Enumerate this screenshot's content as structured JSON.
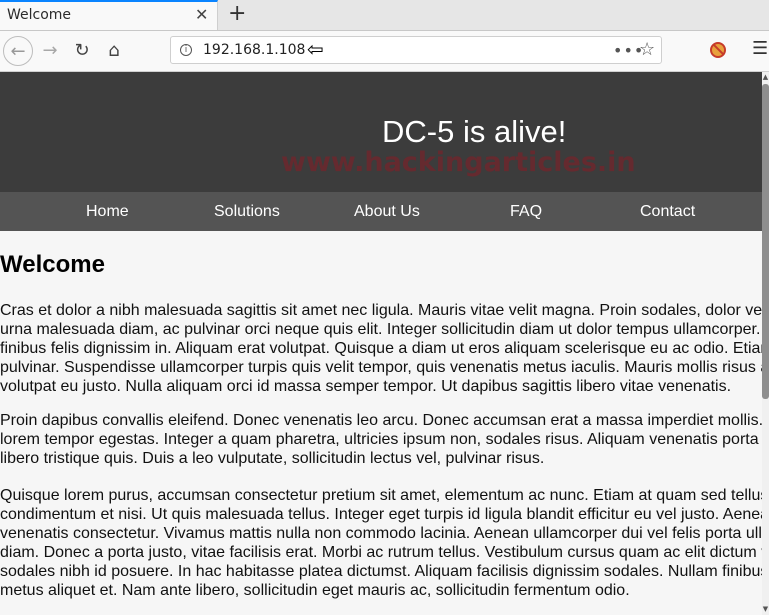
{
  "browser": {
    "tab_title": "Welcome",
    "tab_close": "✕",
    "new_tab": "+",
    "back": "←",
    "forward": "→",
    "reload": "↻",
    "home": "⌂",
    "url": "192.168.1.108",
    "info": "i",
    "cursor": "⇦",
    "page_actions": "•••",
    "bookmark": "☆",
    "menu": "☰"
  },
  "site": {
    "title": "DC-5 is alive!",
    "watermark": "www.hackingarticles.in",
    "nav": [
      "Home",
      "Solutions",
      "About Us",
      "FAQ",
      "Contact"
    ]
  },
  "content": {
    "heading": "Welcome",
    "paragraphs": [
      [
        "Cras et dolor a nibh malesuada sagittis sit amet nec ligula. Mauris vitae velit magna. Proin sodales, dolor vel",
        "urna malesuada diam, ac pulvinar orci neque quis elit. Integer sollicitudin diam ut dolor tempus ullamcorper. P",
        "finibus felis dignissim in. Aliquam erat volutpat. Quisque a diam ut eros aliquam scelerisque eu ac odio. Etiam",
        "pulvinar. Suspendisse ullamcorper turpis quis velit tempor, quis venenatis metus iaculis. Mauris mollis risus a",
        "volutpat eu justo. Nulla aliquam orci id massa semper tempor. Ut dapibus sagittis libero vitae venenatis."
      ],
      [
        "Proin dapibus convallis eleifend. Donec venenatis leo arcu. Donec accumsan erat a massa imperdiet mollis.",
        "lorem tempor egestas. Integer a quam pharetra, ultricies ipsum non, sodales risus. Aliquam venenatis porta ip",
        "libero tristique quis. Duis a leo vulputate, sollicitudin lectus vel, pulvinar risus."
      ],
      [
        "Quisque lorem purus, accumsan consectetur pretium sit amet, elementum ac nunc. Etiam at quam sed tellus r",
        "condimentum et nisi. Ut quis malesuada tellus. Integer eget turpis id ligula blandit efficitur eu vel justo. Aenea",
        "venenatis consectetur. Vivamus mattis nulla non commodo lacinia. Aenean ullamcorper dui vel felis porta ulla",
        "diam. Donec a porta justo, vitae facilisis erat. Morbi ac rutrum tellus. Vestibulum cursus quam ac elit dictum ve",
        "sodales nibh id posuere. In hac habitasse platea dictumst. Aliquam facilisis dignissim sodales. Nullam finibus",
        "metus aliquet et. Nam ante libero, sollicitudin eget mauris ac, sollicitudin fermentum odio."
      ]
    ]
  },
  "scrollbar": {
    "up": "▲",
    "down": "▼"
  }
}
